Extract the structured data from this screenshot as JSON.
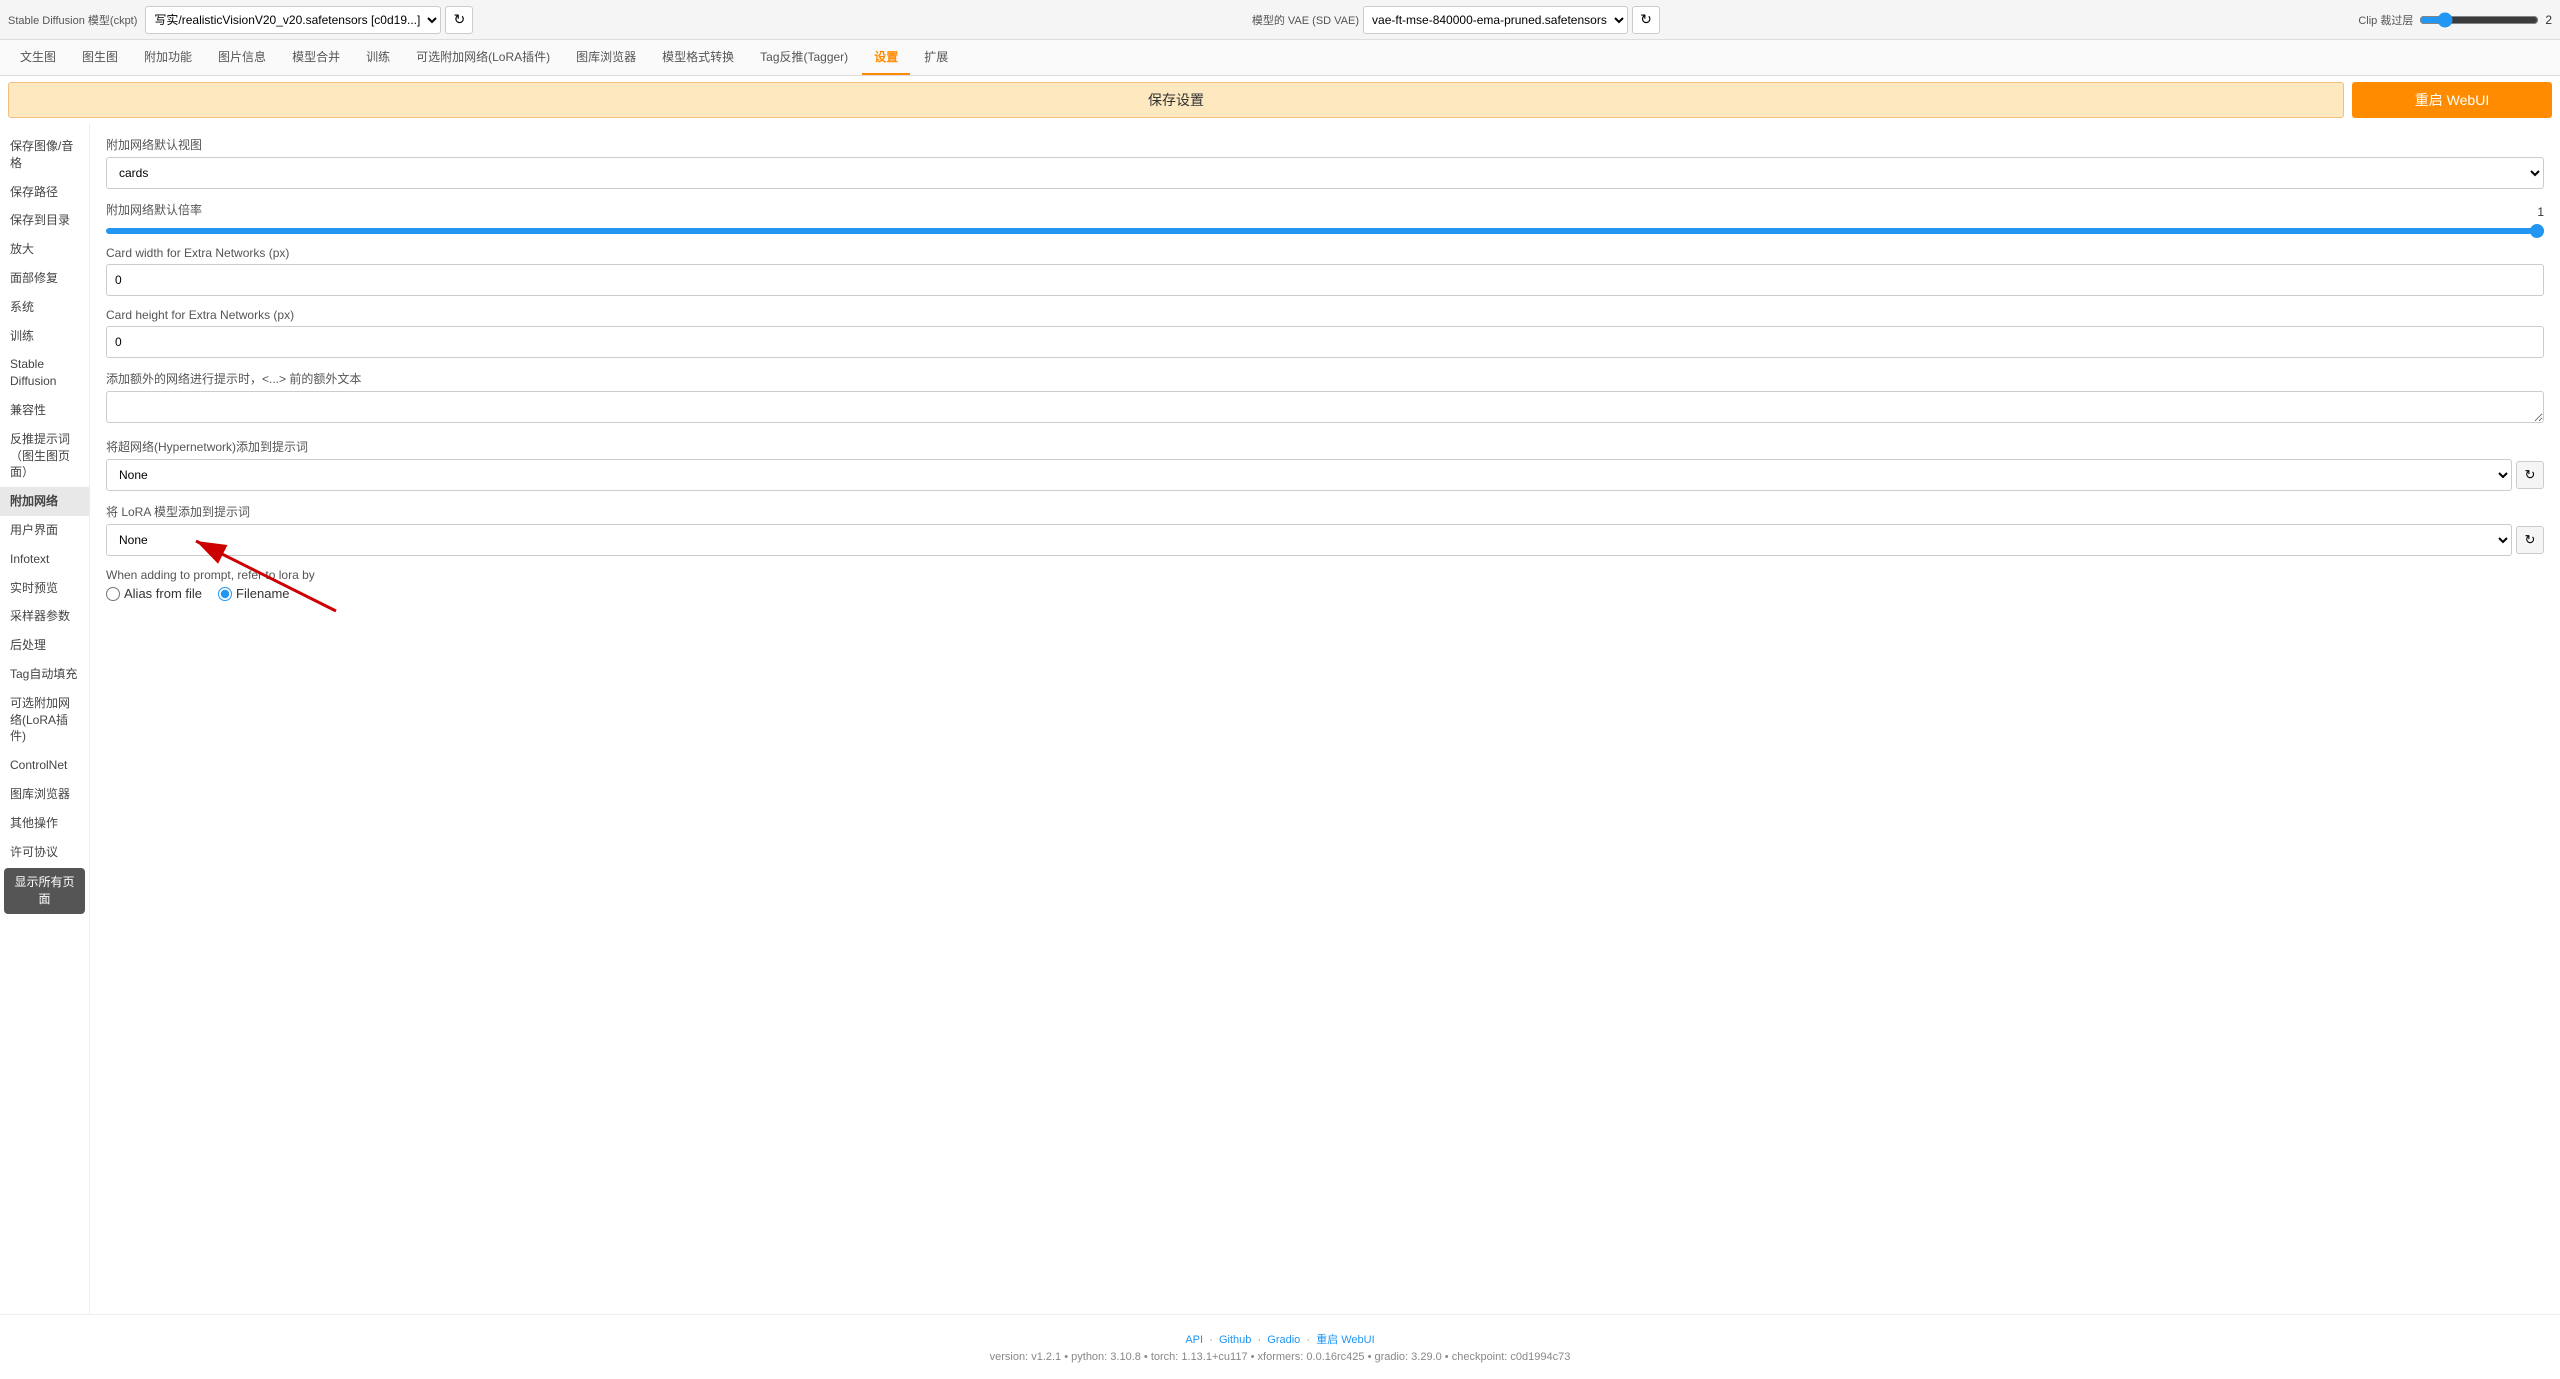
{
  "window": {
    "title": "Stable Diffusion 模型(ckpt)"
  },
  "topbar": {
    "model_label": "写实/realisticVisionV20_v20.safetensors [c0d19...]",
    "vae_label": "模型的 VAE (SD VAE)",
    "vae_value": "vae-ft-mse-840000-ema-pruned.safetensors",
    "clip_label": "Clip 裁过层",
    "clip_value": "2",
    "refresh_icon": "↻"
  },
  "nav": {
    "tabs": [
      {
        "id": "txt2img",
        "label": "文生图"
      },
      {
        "id": "img2img",
        "label": "图生图"
      },
      {
        "id": "extras",
        "label": "附加功能"
      },
      {
        "id": "imginfo",
        "label": "图片信息"
      },
      {
        "id": "merge",
        "label": "模型合并"
      },
      {
        "id": "train",
        "label": "训练"
      },
      {
        "id": "lora",
        "label": "可选附加网络(LoRA插件)"
      },
      {
        "id": "browser",
        "label": "图库浏览器"
      },
      {
        "id": "convert",
        "label": "模型格式转换"
      },
      {
        "id": "tagger",
        "label": "Tag反推(Tagger)"
      },
      {
        "id": "settings",
        "label": "设置",
        "active": true
      },
      {
        "id": "extensions",
        "label": "扩展"
      }
    ]
  },
  "actionbar": {
    "save_label": "保存设置",
    "restart_label": "重启 WebUI"
  },
  "sidebar": {
    "items": [
      {
        "id": "save-img",
        "label": "保存图像/音格"
      },
      {
        "id": "save-path",
        "label": "保存路径"
      },
      {
        "id": "save-dir",
        "label": "保存到目录"
      },
      {
        "id": "zoom",
        "label": "放大"
      },
      {
        "id": "face-fix",
        "label": "面部修复"
      },
      {
        "id": "system",
        "label": "系统"
      },
      {
        "id": "train",
        "label": "训练"
      },
      {
        "id": "sd",
        "label": "Stable Diffusion"
      },
      {
        "id": "compat",
        "label": "兼容性"
      },
      {
        "id": "antialias",
        "label": "反推提示词（图生图页面）"
      },
      {
        "id": "extra-net",
        "label": "附加网络",
        "active": true
      },
      {
        "id": "user-interface",
        "label": "用户界面"
      },
      {
        "id": "infotext",
        "label": "Infotext"
      },
      {
        "id": "live-preview",
        "label": "实时预览"
      },
      {
        "id": "sampler",
        "label": "采样器参数"
      },
      {
        "id": "post",
        "label": "后处理"
      },
      {
        "id": "tag-fill",
        "label": "Tag自动填充"
      },
      {
        "id": "lora-plugin",
        "label": "可选附加网络(LoRA插件)"
      },
      {
        "id": "controlnet",
        "label": "ControlNet"
      },
      {
        "id": "img-browser",
        "label": "图库浏览器"
      },
      {
        "id": "other-ops",
        "label": "其他操作"
      },
      {
        "id": "license",
        "label": "许可协议"
      },
      {
        "id": "show-all",
        "label": "显示所有页面",
        "highlighted": true
      }
    ]
  },
  "content": {
    "section_extra_net": {
      "default_view_label": "附加网络默认视图",
      "default_view_value": "cards",
      "default_multiplier_label": "附加网络默认倍率",
      "default_multiplier_value": 1,
      "card_width_label": "Card width for Extra Networks (px)",
      "card_width_value": "0",
      "card_height_label": "Card height for Extra Networks (px)",
      "card_height_value": "0",
      "extra_text_label": "添加额外的网络进行提示时，<...> 前的额外文本",
      "extra_text_value": "",
      "hypernetwork_label": "将超网络(Hypernetwork)添加到提示词",
      "hypernetwork_value": "None",
      "lora_label": "将 LoRA 模型添加到提示词",
      "lora_value": "None",
      "refer_by_label": "When adding to prompt, refer to lora by",
      "radio_alias": "Alias from file",
      "radio_filename": "Filename",
      "radio_selected": "filename"
    }
  },
  "footer": {
    "links": [
      "API",
      "Github",
      "Gradio",
      "重启 WebUI"
    ],
    "version_info": "version: v1.2.1  •  python: 3.10.8  •  torch: 1.13.1+cu117  •  xformers: 0.0.16rc425  •  gradio: 3.29.0  •  checkpoint: c0d1994c73"
  }
}
